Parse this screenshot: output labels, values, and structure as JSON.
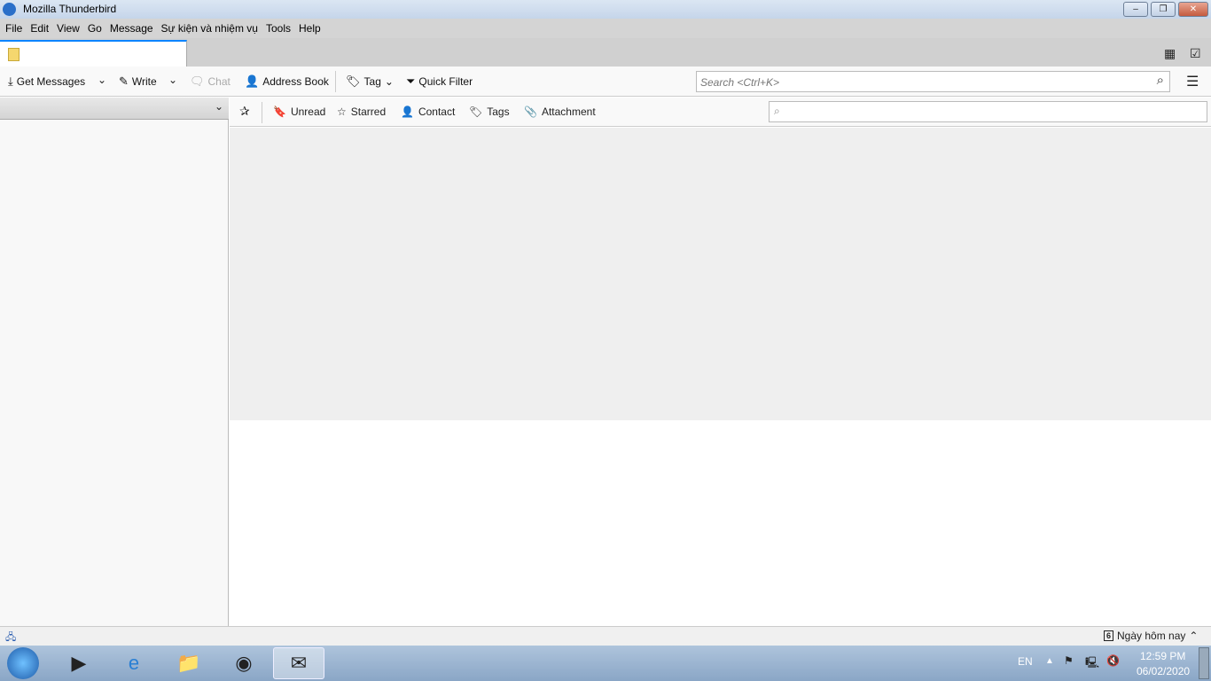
{
  "window": {
    "title": "Mozilla Thunderbird"
  },
  "menu": [
    "File",
    "Edit",
    "View",
    "Go",
    "Message",
    "Sự kiện và nhiệm vụ",
    "Tools",
    "Help"
  ],
  "toolbar": {
    "get_messages": "Get Messages",
    "write": "Write",
    "chat": "Chat",
    "address_book": "Address Book",
    "tag": "Tag",
    "quick_filter": "Quick Filter",
    "search_placeholder": "Search <Ctrl+K>"
  },
  "quickfilter": {
    "unread": "Unread",
    "starred": "Starred",
    "contact": "Contact",
    "tags": "Tags",
    "attachment": "Attachment"
  },
  "statusbar": {
    "today": "Ngày hôm nay",
    "calendar_day": "6"
  },
  "taskbar": {
    "lang": "EN",
    "time": "12:59 PM",
    "date": "06/02/2020"
  }
}
